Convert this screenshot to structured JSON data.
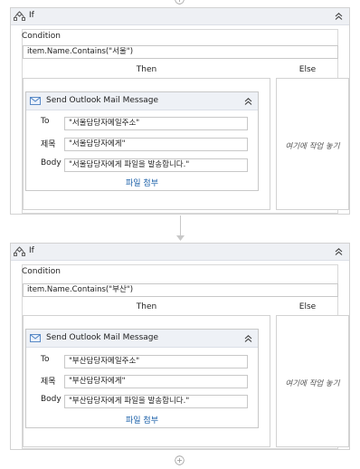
{
  "if_blocks": [
    {
      "title": "If",
      "condition_label": "Condition",
      "condition_value": "item.Name.Contains(\"서울\")",
      "then_label": "Then",
      "else_label": "Else",
      "else_drop_text": "여기에 작업 놓기",
      "activity": {
        "title": "Send Outlook Mail Message",
        "fields": [
          {
            "label": "To",
            "value": "\"서울담당자메일주소\""
          },
          {
            "label": "제목",
            "value": "\"서울담당자에게\""
          },
          {
            "label": "Body",
            "value": "\"서울담당자에게 파일을 발송합니다.\""
          }
        ],
        "attach_label": "파일 첨부"
      }
    },
    {
      "title": "If",
      "condition_label": "Condition",
      "condition_value": "item.Name.Contains(\"부산\")",
      "then_label": "Then",
      "else_label": "Else",
      "else_drop_text": "여기에 작업 놓기",
      "activity": {
        "title": "Send Outlook Mail Message",
        "fields": [
          {
            "label": "To",
            "value": "\"부산담당자메일주소\""
          },
          {
            "label": "제목",
            "value": "\"부산담당자에게\""
          },
          {
            "label": "Body",
            "value": "\"부산담당자에게 파일을 발송합니다.\""
          }
        ],
        "attach_label": "파일 첨부"
      }
    }
  ],
  "icons": {
    "if_icon": "if-activity-icon",
    "collapse": "double-chevron-up-icon",
    "mail": "outlook-mail-icon",
    "add": "add-activity-plus-icon"
  },
  "colors": {
    "header_bg": "#eef0f4",
    "border": "#d2d2d2",
    "link": "#1a5fa8"
  }
}
